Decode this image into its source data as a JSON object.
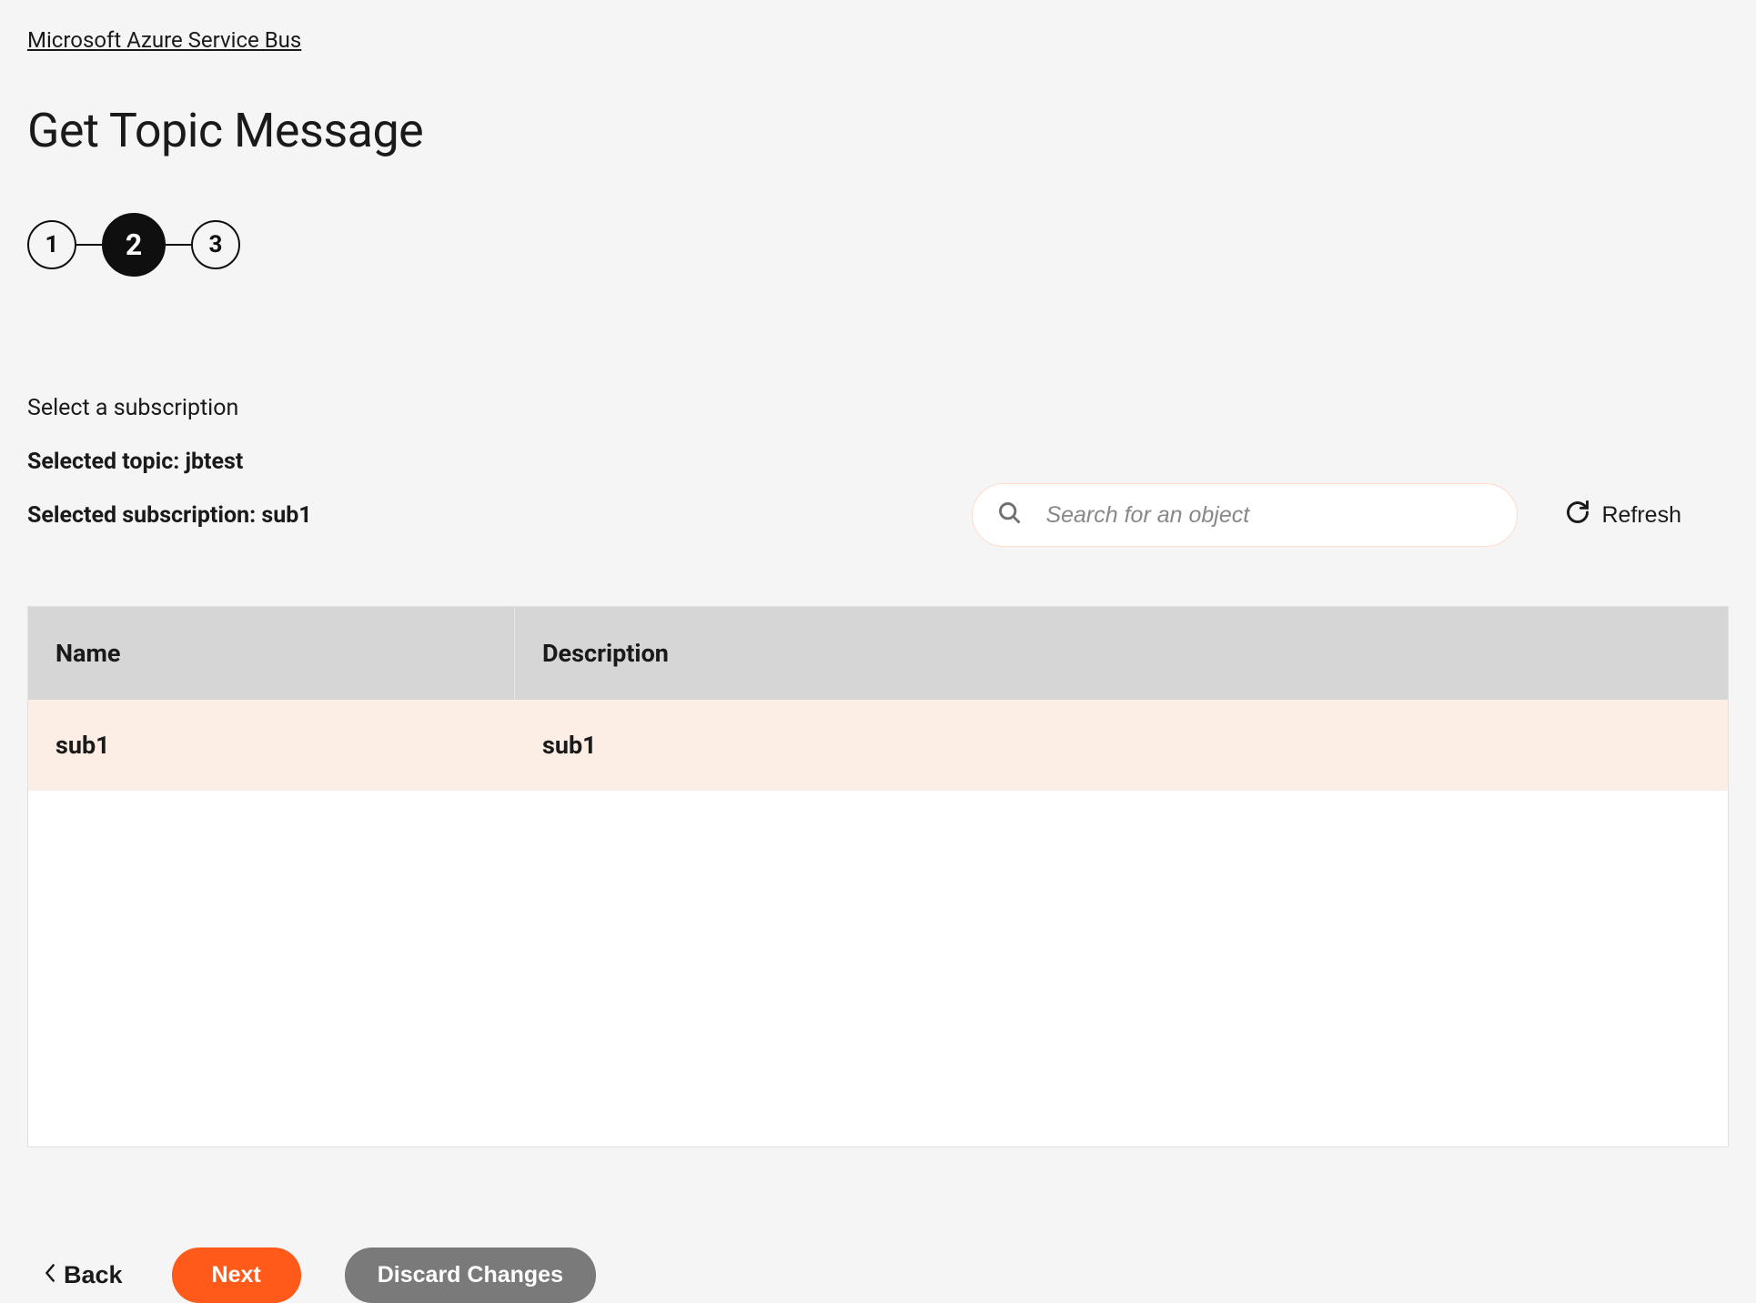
{
  "breadcrumb": {
    "label": "Microsoft Azure Service Bus"
  },
  "page_title": "Get Topic Message",
  "stepper": {
    "steps": [
      "1",
      "2",
      "3"
    ],
    "active_index": 1
  },
  "subtitle": "Select a subscription",
  "selected_topic_label": "Selected topic: jbtest",
  "selected_subscription_label": "Selected subscription: sub1",
  "search": {
    "placeholder": "Search for an object"
  },
  "refresh_label": "Refresh",
  "table": {
    "headers": {
      "name": "Name",
      "description": "Description"
    },
    "rows": [
      {
        "name": "sub1",
        "description": "sub1"
      }
    ]
  },
  "buttons": {
    "back": "Back",
    "next": "Next",
    "discard": "Discard Changes"
  }
}
